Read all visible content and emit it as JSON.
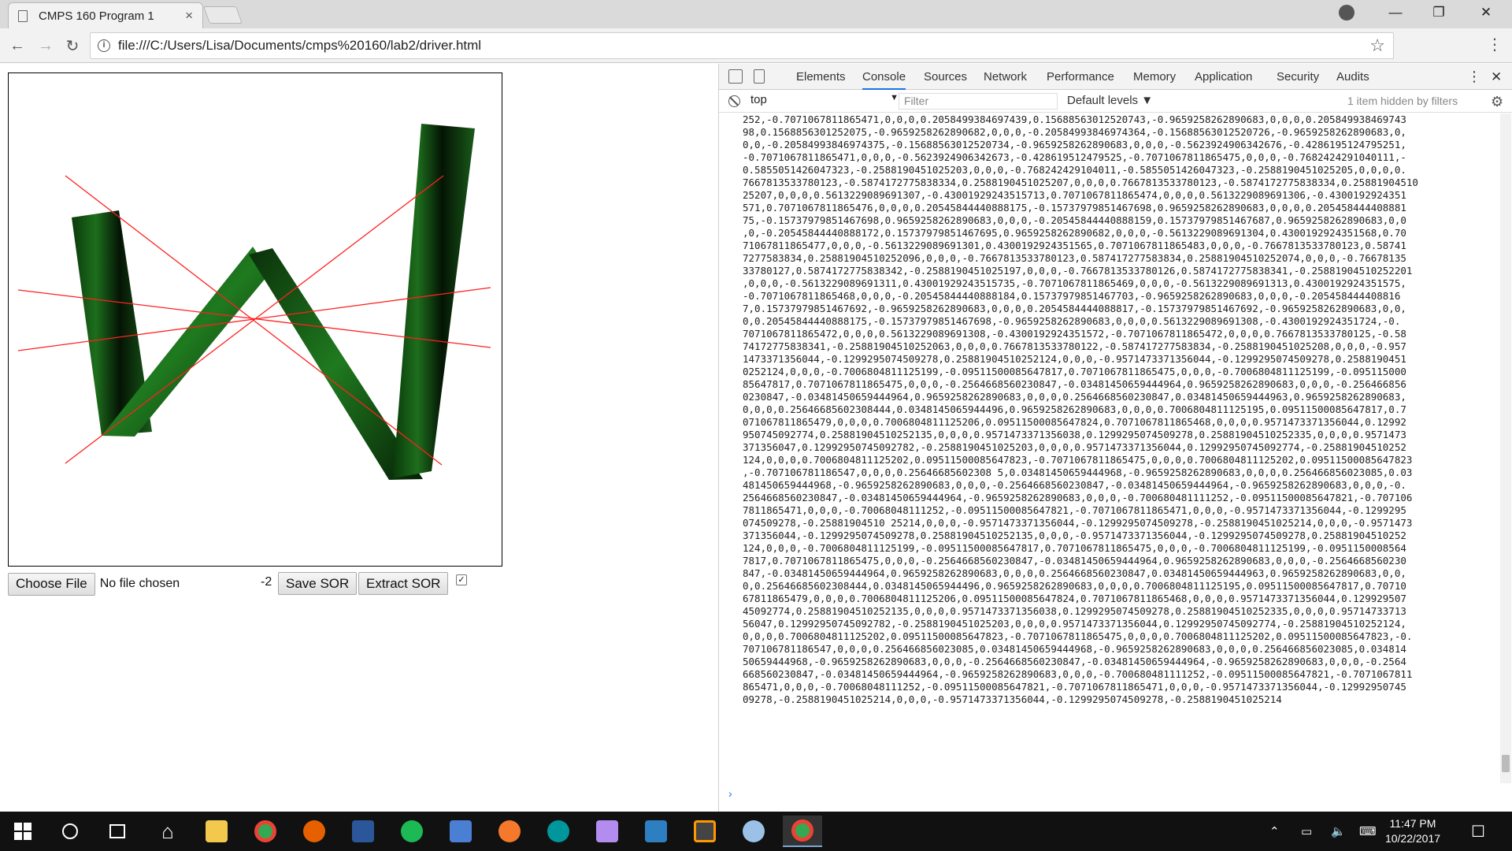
{
  "browser": {
    "tab_title": "CMPS 160 Program 1",
    "tab_close": "×",
    "url": "file:///C:/Users/Lisa/Documents/cmps%20160/lab2/driver.html"
  },
  "page": {
    "choose_file_label": "Choose File",
    "no_file_text": "No file chosen",
    "number_value": "-2",
    "save_label": "Save SOR",
    "extract_label": "Extract SOR",
    "checkbox_checked": true,
    "checkbox_mark": "✓"
  },
  "devtools": {
    "tabs": [
      "Elements",
      "Console",
      "Sources",
      "Network",
      "Performance",
      "Memory",
      "Application",
      "Security",
      "Audits"
    ],
    "active_tab": "Console",
    "context": "top",
    "filter_placeholder": "Filter",
    "levels": "Default levels ▼",
    "hidden_text": "1 item hidden by filters",
    "console_output": "252,-0.7071067811865471,0,0,0,0.2058499384697439,0.15688563012520743,-0.9659258262890683,0,0,0,0.205849938469743\n98,0.1568856301252075,-0.9659258262890682,0,0,0,-0.20584993846974364,-0.15688563012520726,-0.9659258262890683,0,\n0,0,-0.20584993846974375,-0.15688563012520734,-0.9659258262890683,0,0,0,-0.5623924906342676,-0.4286195124795251,\n-0.7071067811865471,0,0,0,-0.5623924906342673,-0.428619512479525,-0.7071067811865475,0,0,0,-0.7682424291040111,-\n0.5855051426047323,-0.2588190451025203,0,0,0,-0.768242429104011,-0.5855051426047323,-0.2588190451025205,0,0,0,0.\n7667813533780123,-0.5874172775838334,0.2588190451025207,0,0,0,0.7667813533780123,-0.5874172775838334,0.25881904510\n25207,0,0,0,0.5613229089691307,-0.43001929243515713,0.7071067811865474,0,0,0,0.5613229089691306,-0.4300192924351\n571,0.7071067811865476,0,0,0,0.20545844440888175,-0.15737979851467698,0.9659258262890683,0,0,0,0.205458444408881\n75,-0.15737979851467698,0.9659258262890683,0,0,0,-0.20545844440888159,0.15737979851467687,0.9659258262890683,0,0\n,0,-0.20545844440888172,0.15737979851467695,0.9659258262890682,0,0,0,-0.5613229089691304,0.4300192924351568,0.70\n71067811865477,0,0,0,-0.5613229089691301,0.4300192924351565,0.7071067811865483,0,0,0,-0.7667813533780123,0.58741\n7277583834,0.25881904510252096,0,0,0,-0.7667813533780123,0.587417277583834,0.25881904510252074,0,0,0,-0.76678135\n33780127,0.5874172775838342,-0.2588190451025197,0,0,0,-0.7667813533780126,0.5874172775838341,-0.25881904510252201\n,0,0,0,-0.5613229089691311,0.43001929243515735,-0.7071067811865469,0,0,0,-0.5613229089691313,0.4300192924351575,\n-0.7071067811865468,0,0,0,-0.20545844440888184,0.15737979851467703,-0.9659258262890683,0,0,0,-0.205458444408816\n7,0.15737979851467692,-0.9659258262890683,0,0,0,0.2054584444088817,-0.15737979851467692,-0.9659258262890683,0,0,\n0,0.20545844440888175,-0.15737979851467698,-0.9659258262890683,0,0,0,0.5613229089691308,-0.4300192924351724,-0.\n7071067811865472,0,0,0,0.5613229089691308,-0.4300192924351572,-0.7071067811865472,0,0,0,0.7667813533780125,-0.58\n74172775838341,-0.25881904510252063,0,0,0,0.7667813533780122,-0.587417277583834,-0.2588190451025208,0,0,0,-0.957\n1473371356044,-0.1299295074509278,0.25881904510252124,0,0,0,-0.9571473371356044,-0.1299295074509278,0.2588190451\n0252124,0,0,0,-0.7006804811125199,-0.09511500085647817,0.7071067811865475,0,0,0,-0.7006804811125199,-0.095115000\n85647817,0.7071067811865475,0,0,0,-0.2564668560230847,-0.03481450659444964,0.9659258262890683,0,0,0,-0.256466856\n0230847,-0.03481450659444964,0.9659258262890683,0,0,0,0.2564668560230847,0.03481450659444963,0.9659258262890683,\n0,0,0,0.25646685602308444,0.0348145065944496,0.9659258262890683,0,0,0,0.7006804811125195,0.09511500085647817,0.7\n071067811865479,0,0,0,0.7006804811125206,0.09511500085647824,0.7071067811865468,0,0,0,0.9571473371356044,0.12992\n950745092774,0.25881904510252135,0,0,0,0.9571473371356038,0.1299295074509278,0.25881904510252335,0,0,0,0.9571473\n371356047,0.12992950745092782,-0.2588190451025203,0,0,0,0.9571473371356044,0.12992950745092774,-0.25881904510252\n124,0,0,0,0.7006804811125202,0.09511500085647823,-0.7071067811865475,0,0,0,0.7006804811125202,0.09511500085647823\n,-0.707106781186547,0,0,0,0.25646685602308 5,0.03481450659444968,-0.9659258262890683,0,0,0,0.256466856023085,0.03\n481450659444968,-0.9659258262890683,0,0,0,-0.2564668560230847,-0.03481450659444964,-0.9659258262890683,0,0,0,-0.\n2564668560230847,-0.03481450659444964,-0.9659258262890683,0,0,0,-0.700680481111252,-0.09511500085647821,-0.707106\n7811865471,0,0,0,-0.70068048111252,-0.09511500085647821,-0.7071067811865471,0,0,0,-0.9571473371356044,-0.1299295\n074509278,-0.25881904510 25214,0,0,0,-0.9571473371356044,-0.1299295074509278,-0.2588190451025214,0,0,0,-0.9571473\n371356044,-0.1299295074509278,0.25881904510252135,0,0,0,-0.9571473371356044,-0.1299295074509278,0.25881904510252\n124,0,0,0,-0.7006804811125199,-0.09511500085647817,0.7071067811865475,0,0,0,-0.7006804811125199,-0.0951150008564\n7817,0.7071067811865475,0,0,0,-0.2564668560230847,-0.03481450659444964,0.9659258262890683,0,0,0,-0.2564668560230\n847,-0.03481450659444964,0.9659258262890683,0,0,0,0.2564668560230847,0.03481450659444963,0.9659258262890683,0,0,\n0,0.25646685602308444,0.0348145065944496,0.9659258262890683,0,0,0,0.7006804811125195,0.09511500085647817,0.70710\n67811865479,0,0,0,0.7006804811125206,0.09511500085647824,0.7071067811865468,0,0,0,0.9571473371356044,0.129929507\n45092774,0.25881904510252135,0,0,0,0.9571473371356038,0.1299295074509278,0.25881904510252335,0,0,0,0.95714733713\n56047,0.12992950745092782,-0.2588190451025203,0,0,0,0.9571473371356044,0.12992950745092774,-0.25881904510252124,\n0,0,0,0.7006804811125202,0.09511500085647823,-0.7071067811865475,0,0,0,0.7006804811125202,0.09511500085647823,-0.\n707106781186547,0,0,0,0.256466856023085,0.03481450659444968,-0.9659258262890683,0,0,0,0.256466856023085,0.034814\n50659444968,-0.9659258262890683,0,0,0,-0.2564668560230847,-0.03481450659444964,-0.9659258262890683,0,0,0,-0.2564\n668560230847,-0.03481450659444964,-0.9659258262890683,0,0,0,-0.700680481111252,-0.09511500085647821,-0.7071067811\n865471,0,0,0,-0.70068048111252,-0.09511500085647821,-0.7071067811865471,0,0,0,-0.9571473371356044,-0.12992950745\n09278,-0.2588190451025214,0,0,0,-0.9571473371356044,-0.1299295074509278,-0.2588190451025214",
    "prompt_symbol": "›"
  },
  "taskbar": {
    "time": "11:47 PM",
    "date": "10/22/2017",
    "apps": [
      {
        "name": "start-button",
        "color": "#ffffff"
      },
      {
        "name": "search-button",
        "color": "#ffffff"
      },
      {
        "name": "task-view-button",
        "color": "#ffffff"
      },
      {
        "name": "home-app",
        "color": "#ffffff"
      },
      {
        "name": "file-explorer-app",
        "color": "#f2c94c"
      },
      {
        "name": "chrome-app",
        "color": "#34a853"
      },
      {
        "name": "firefox-app",
        "color": "#e66000"
      },
      {
        "name": "word-app",
        "color": "#2b579a"
      },
      {
        "name": "spotify-app",
        "color": "#1db954"
      },
      {
        "name": "network-app",
        "color": "#4a7fd4"
      },
      {
        "name": "blender-app",
        "color": "#f5792a"
      },
      {
        "name": "arduino-app",
        "color": "#00979c"
      },
      {
        "name": "purple-app",
        "color": "#b38cf0"
      },
      {
        "name": "bracket-app",
        "color": "#2d7fc1"
      },
      {
        "name": "sublime-app",
        "color": "#ff9800"
      },
      {
        "name": "paint-app",
        "color": "#9bc2e6"
      },
      {
        "name": "chrome-active-app",
        "color": "#34a853"
      }
    ]
  },
  "colors": {
    "line": "#ff2020",
    "shape_dark": "#0b2a0b",
    "shape_light": "#1f7a1f"
  }
}
